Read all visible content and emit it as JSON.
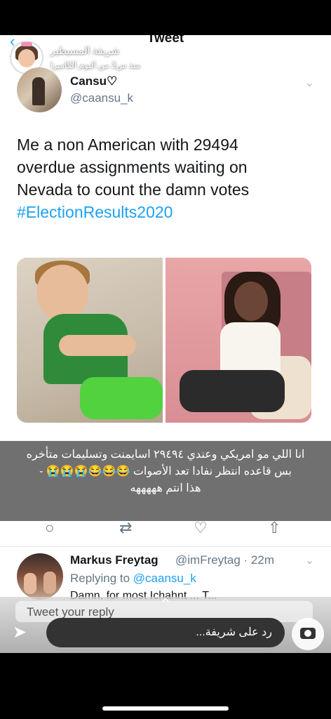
{
  "header": {
    "title": "Tweet",
    "story_name": "شريفة المسيطير",
    "story_time": "منذ س2 من البوم الكاميرا"
  },
  "tweet": {
    "author_name": "Cansu♡",
    "author_handle": "@caansu_k",
    "text_line1": "Me a non American with 29494",
    "text_line2": "overdue assignments waiting on",
    "text_line3": "Nevada to count the damn votes",
    "hashtag": "#ElectionResults2020"
  },
  "caption": {
    "line1": "انا اللي مو امريكي وعندي ٢٩٤٩٤ اسايمنت وتسليمات متأخره",
    "line2": "بس قاعده انتظر نفادا تعد الأصوات 😂😂😂😭😭😭 -",
    "line3": "هذا انتم هههههه"
  },
  "actions": {
    "reply_icon": "○",
    "retweet_icon": "⇄",
    "like_icon": "♡",
    "share_icon": "⇧"
  },
  "reply": {
    "author_name": "Markus Freytag",
    "meta": "@imFreytag · 22m",
    "replying_prefix": "Replying to",
    "replying_mention": "@caansu_k",
    "snippet": "Damn, for most Ichahnt ... T..."
  },
  "compose": {
    "placeholder": "Tweet your reply",
    "story_reply_placeholder": "رد على شريفة..."
  },
  "colors": {
    "accent": "#1da1f2",
    "text": "#14171a",
    "muted": "#657786"
  }
}
